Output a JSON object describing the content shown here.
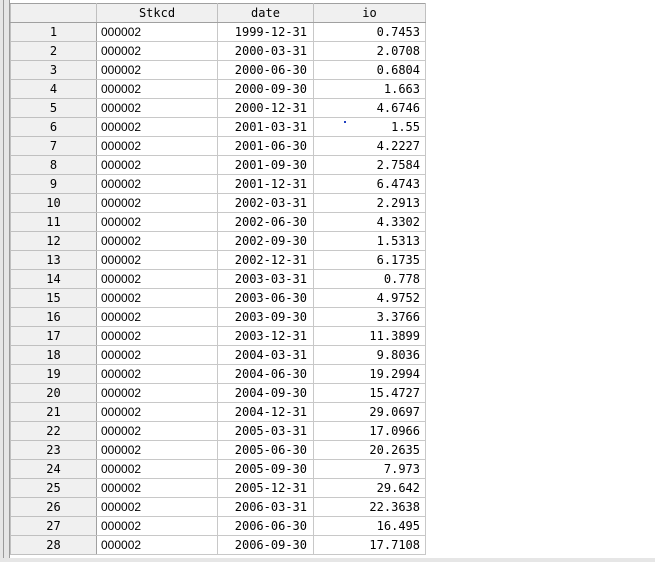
{
  "columns": [
    "",
    "Stkcd",
    "date",
    "io"
  ],
  "rows": [
    {
      "n": "1",
      "stkcd": "000002",
      "date": "1999-12-31",
      "io": "0.7453"
    },
    {
      "n": "2",
      "stkcd": "000002",
      "date": "2000-03-31",
      "io": "2.0708"
    },
    {
      "n": "3",
      "stkcd": "000002",
      "date": "2000-06-30",
      "io": "0.6804"
    },
    {
      "n": "4",
      "stkcd": "000002",
      "date": "2000-09-30",
      "io": "1.663"
    },
    {
      "n": "5",
      "stkcd": "000002",
      "date": "2000-12-31",
      "io": "4.6746"
    },
    {
      "n": "6",
      "stkcd": "000002",
      "date": "2001-03-31",
      "io": "1.55"
    },
    {
      "n": "7",
      "stkcd": "000002",
      "date": "2001-06-30",
      "io": "4.2227"
    },
    {
      "n": "8",
      "stkcd": "000002",
      "date": "2001-09-30",
      "io": "2.7584"
    },
    {
      "n": "9",
      "stkcd": "000002",
      "date": "2001-12-31",
      "io": "6.4743"
    },
    {
      "n": "10",
      "stkcd": "000002",
      "date": "2002-03-31",
      "io": "2.2913"
    },
    {
      "n": "11",
      "stkcd": "000002",
      "date": "2002-06-30",
      "io": "4.3302"
    },
    {
      "n": "12",
      "stkcd": "000002",
      "date": "2002-09-30",
      "io": "1.5313"
    },
    {
      "n": "13",
      "stkcd": "000002",
      "date": "2002-12-31",
      "io": "6.1735"
    },
    {
      "n": "14",
      "stkcd": "000002",
      "date": "2003-03-31",
      "io": "0.778"
    },
    {
      "n": "15",
      "stkcd": "000002",
      "date": "2003-06-30",
      "io": "4.9752"
    },
    {
      "n": "16",
      "stkcd": "000002",
      "date": "2003-09-30",
      "io": "3.3766"
    },
    {
      "n": "17",
      "stkcd": "000002",
      "date": "2003-12-31",
      "io": "11.3899"
    },
    {
      "n": "18",
      "stkcd": "000002",
      "date": "2004-03-31",
      "io": "9.8036"
    },
    {
      "n": "19",
      "stkcd": "000002",
      "date": "2004-06-30",
      "io": "19.2994"
    },
    {
      "n": "20",
      "stkcd": "000002",
      "date": "2004-09-30",
      "io": "15.4727"
    },
    {
      "n": "21",
      "stkcd": "000002",
      "date": "2004-12-31",
      "io": "29.0697"
    },
    {
      "n": "22",
      "stkcd": "000002",
      "date": "2005-03-31",
      "io": "17.0966"
    },
    {
      "n": "23",
      "stkcd": "000002",
      "date": "2005-06-30",
      "io": "20.2635"
    },
    {
      "n": "24",
      "stkcd": "000002",
      "date": "2005-09-30",
      "io": "7.973"
    },
    {
      "n": "25",
      "stkcd": "000002",
      "date": "2005-12-31",
      "io": "29.642"
    },
    {
      "n": "26",
      "stkcd": "000002",
      "date": "2006-03-31",
      "io": "22.3638"
    },
    {
      "n": "27",
      "stkcd": "000002",
      "date": "2006-06-30",
      "io": "16.495"
    },
    {
      "n": "28",
      "stkcd": "000002",
      "date": "2006-09-30",
      "io": "17.7108"
    }
  ]
}
